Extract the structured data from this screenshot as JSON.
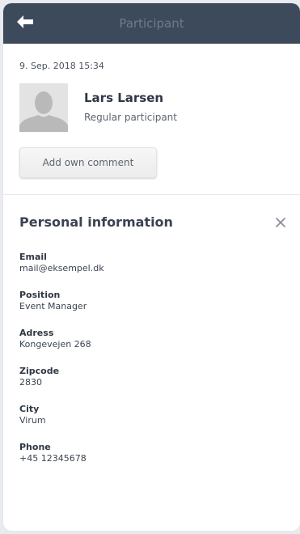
{
  "header": {
    "title": "Participant",
    "back_icon": "arrow-left-icon"
  },
  "entry": {
    "timestamp": "9. Sep. 2018 15:34"
  },
  "participant": {
    "avatar_icon": "user-silhouette-icon",
    "name": "Lars Larsen",
    "role": "Regular participant"
  },
  "actions": {
    "comment_label": "Add own comment"
  },
  "personal_info": {
    "title": "Personal information",
    "close_icon": "close-icon",
    "fields": [
      {
        "label": "Email",
        "value": "mail@eksempel.dk"
      },
      {
        "label": "Position",
        "value": "Event Manager"
      },
      {
        "label": "Adress",
        "value": "Kongevejen 268"
      },
      {
        "label": "Zipcode",
        "value": "2830"
      },
      {
        "label": "City",
        "value": "Virum"
      },
      {
        "label": "Phone",
        "value": "+45 12345678"
      }
    ]
  },
  "colors": {
    "header_bg": "#3d4a5c",
    "header_title": "#6e7b8c",
    "text_dark": "#2f3744"
  }
}
